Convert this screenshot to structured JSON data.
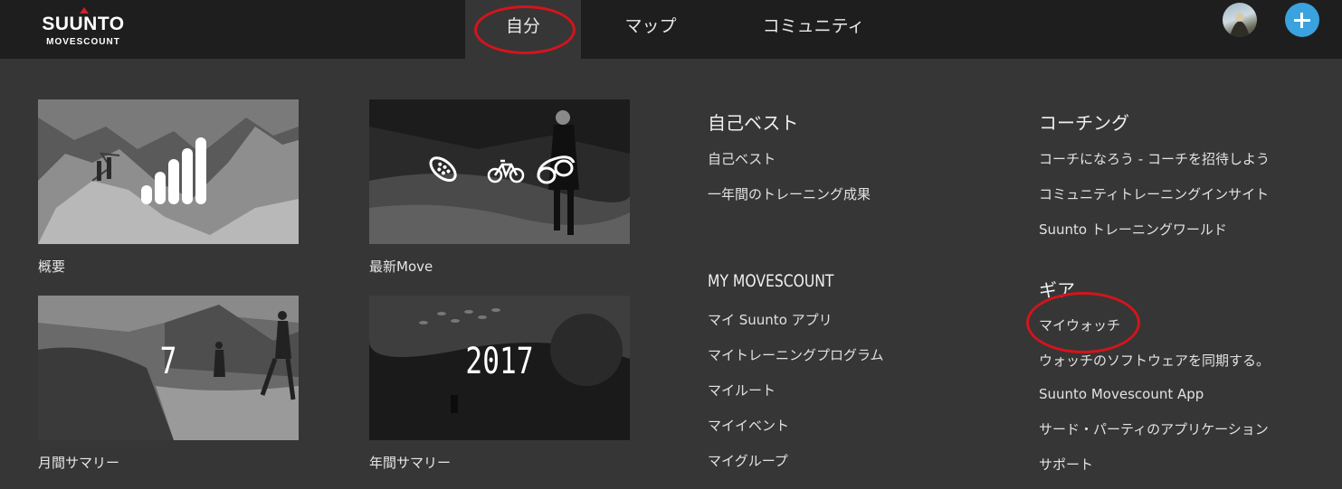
{
  "header": {
    "logo": {
      "brand": "SUUNTO",
      "sub": "MOVESCOUNT"
    },
    "tabs": [
      {
        "label": "自分",
        "active": true
      },
      {
        "label": "マップ",
        "active": false
      },
      {
        "label": "コミュニティ",
        "active": false
      }
    ],
    "avatar_icon": "user-avatar",
    "add_icon": "plus-icon"
  },
  "tiles": [
    {
      "label": "概要",
      "icon": "signal-bars-icon"
    },
    {
      "label": "最新Move",
      "icons": [
        "running-shoe-icon",
        "bicycle-icon",
        "swim-goggles-icon"
      ]
    },
    {
      "label": "月間サマリー",
      "number": "7"
    },
    {
      "label": "年間サマリー",
      "number": "2017"
    }
  ],
  "columns": {
    "personal_best": {
      "heading": "自己ベスト",
      "links": [
        "自己ベスト",
        "一年間のトレーニング成果"
      ]
    },
    "coaching": {
      "heading": "コーチング",
      "links": [
        "コーチになろう - コーチを招待しよう",
        "コミュニティトレーニングインサイト",
        "Suunto トレーニングワールド"
      ]
    },
    "my_movescount": {
      "heading": "MY MOVESCOUNT",
      "links": [
        "マイ Suunto アプリ",
        "マイトレーニングプログラム",
        "マイルート",
        "マイイベント",
        "マイグループ"
      ]
    },
    "gear": {
      "heading": "ギア",
      "links": [
        "マイウォッチ",
        "ウォッチのソフトウェアを同期する。",
        "Suunto Movescount App",
        "サード・パーティのアプリケーション",
        "サポート"
      ]
    }
  },
  "colors": {
    "background": "#363636",
    "topbar": "#1e1e1e",
    "accent_blue": "#3aa2de",
    "annotation_red": "#d4141c"
  }
}
